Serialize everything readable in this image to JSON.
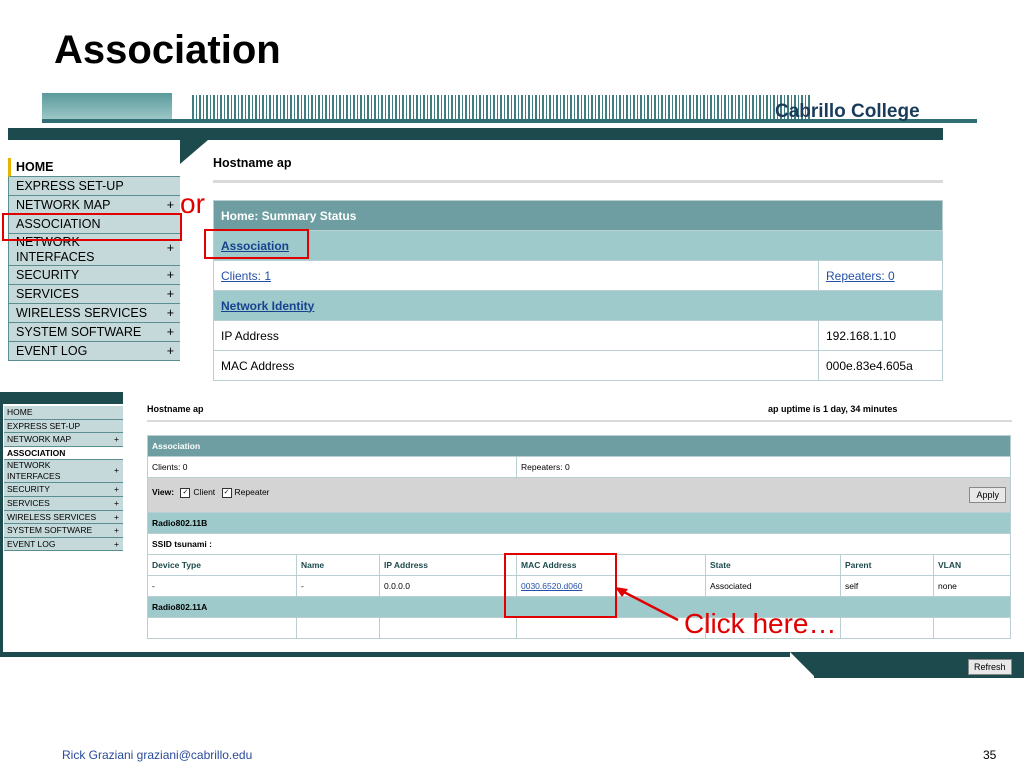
{
  "slide": {
    "title": "Association",
    "footer_author": "Rick Graziani  graziani@cabrillo.edu",
    "page_number": "35",
    "brand": "Cabrillo College"
  },
  "top_screen": {
    "menu": [
      {
        "label": "HOME",
        "plus": ""
      },
      {
        "label": "EXPRESS SET-UP",
        "plus": ""
      },
      {
        "label": "NETWORK MAP",
        "plus": "+"
      },
      {
        "label": "ASSOCIATION",
        "plus": ""
      },
      {
        "label": "NETWORK INTERFACES",
        "plus": "+"
      },
      {
        "label": "SECURITY",
        "plus": "+"
      },
      {
        "label": "SERVICES",
        "plus": "+"
      },
      {
        "label": "WIRELESS SERVICES",
        "plus": "+"
      },
      {
        "label": "SYSTEM SOFTWARE",
        "plus": "+"
      },
      {
        "label": "EVENT LOG",
        "plus": "+"
      }
    ],
    "hostname": "Hostname  ap",
    "header": "Home: Summary Status",
    "association_link": "Association",
    "clients": "Clients: 1",
    "repeaters": "Repeaters: 0",
    "network_identity": "Network Identity",
    "ip_label": "IP Address",
    "ip_value": "192.168.1.10",
    "mac_label": "MAC Address",
    "mac_value": "000e.83e4.605a"
  },
  "bottom_screen": {
    "menu": [
      {
        "label": "HOME",
        "plus": ""
      },
      {
        "label": "EXPRESS SET-UP",
        "plus": ""
      },
      {
        "label": "NETWORK MAP",
        "plus": "+"
      },
      {
        "label": "ASSOCIATION",
        "plus": ""
      },
      {
        "label": "NETWORK INTERFACES",
        "plus": "+"
      },
      {
        "label": "SECURITY",
        "plus": "+"
      },
      {
        "label": "SERVICES",
        "plus": "+"
      },
      {
        "label": "WIRELESS SERVICES",
        "plus": "+"
      },
      {
        "label": "SYSTEM SOFTWARE",
        "plus": "+"
      },
      {
        "label": "EVENT LOG",
        "plus": "+"
      }
    ],
    "hostname": "Hostname  ap",
    "uptime": "ap uptime is 1 day, 34 minutes",
    "header": "Association",
    "clients": "Clients: 0",
    "repeaters": "Repeaters: 0",
    "view_label": "View:",
    "client_check_label": "Client",
    "repeater_check_label": "Repeater",
    "apply": "Apply",
    "radio_b": "Radio802.11B",
    "ssid": "SSID tsunami :",
    "columns": [
      "Device Type",
      "Name",
      "IP Address",
      "MAC Address",
      "State",
      "Parent",
      "VLAN"
    ],
    "row": [
      "-",
      "-",
      "0.0.0.0",
      "0030.6520.d060",
      "Associated",
      "self",
      "none"
    ],
    "radio_a": "Radio802.11A",
    "refresh": "Refresh"
  },
  "annotations": {
    "or": "or",
    "click_here": "Click here…"
  },
  "colors": {
    "teal_dark": "#1d4a4c",
    "teal_header": "#6e9ea1",
    "teal_light": "#9ecacc",
    "annotation_red": "#e00000"
  }
}
